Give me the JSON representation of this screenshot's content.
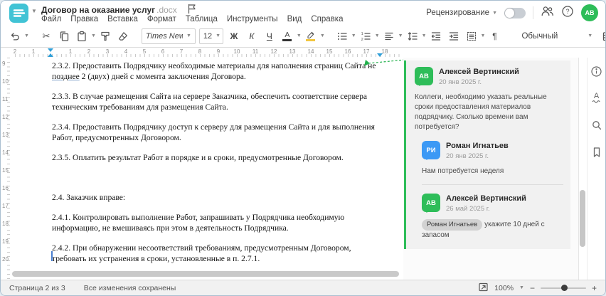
{
  "window": {
    "title": "Договор на оказание услуг",
    "title_ext": ".docx"
  },
  "menu": {
    "items": [
      "Файл",
      "Правка",
      "Вставка",
      "Формат",
      "Таблица",
      "Инструменты",
      "Вид",
      "Справка"
    ]
  },
  "topbar": {
    "review": "Рецензирование",
    "avatar_initials": "АВ"
  },
  "toolbar": {
    "font": "Times New ...",
    "size": "12",
    "bold": "Ж",
    "italic": "К",
    "underline": "Ч",
    "font_color_letter": "А",
    "style": "Обычный",
    "pilcrow": "¶",
    "more": "⋯"
  },
  "ruler": {
    "h_neg": [
      "2",
      "1"
    ],
    "h_pos": [
      "1",
      "2",
      "3",
      "4",
      "5",
      "6",
      "7",
      "8",
      "9",
      "10",
      "11",
      "12",
      "13",
      "14",
      "15",
      "16",
      "17",
      "18"
    ],
    "v": [
      "9",
      "10",
      "11",
      "12",
      "13",
      "14",
      "15",
      "16",
      "17",
      "18",
      "19",
      "20"
    ]
  },
  "doc": {
    "p1": {
      "pre": "2.3.2. Предоставить Подрядчику необходимые материалы для наполнения страниц Сайта не ",
      "underlined": "позднее",
      "post": " 2 (двух) дней с момента заключения Договора."
    },
    "p2": "2.3.3. В случае размещения Сайта на сервере Заказчика, обеспечить соответствие сервера техническим требованиям для размещения Сайта.",
    "p3": "2.3.4. Предоставить Подрядчику доступ к серверу для размещения Сайта и для выполнения Работ, предусмотренных Договором.",
    "p4": "2.3.5. Оплатить результат Работ в порядке и в сроки, предусмотренные Договором.",
    "p5": "2.4. Заказчик вправе:",
    "p6": "2.4.1. Контролировать выполнение Работ, запрашивать у Подрядчика необходимую информацию, не вмешиваясь при этом в деятельность Подрядчика.",
    "p7": "2.4.2. При обнаружении несоответствий требованиям, предусмотренным Договором, требовать их устранения в сроки, установленные в п. 2.7.1."
  },
  "comments": {
    "post1": {
      "initials": "АВ",
      "author": "Алексей Вертинский",
      "date": "20 янв 2025 г.",
      "text": "Коллеги, необходимо указать реальные сроки предоставления материалов подрядчику. Сколько времени вам потребуется?"
    },
    "reply1": {
      "initials": "РИ",
      "author": "Роман Игнатьев",
      "date": "20 янв 2025 г.",
      "text": "Нам потребуется неделя"
    },
    "reply2": {
      "initials": "АВ",
      "author": "Алексей Вертинский",
      "date": "26 май 2025 г.",
      "mention": "Роман Игнатьев",
      "text": "укажите 10 дней с запасом"
    }
  },
  "statusbar": {
    "page": "Страница 2 из 3",
    "saved": "Все изменения сохранены",
    "zoom": "100%",
    "zoom_out": "−",
    "zoom_in": "+"
  },
  "colors": {
    "teal": "#41c3d5",
    "green": "#2ebd59",
    "blue": "#3c99f5",
    "image_icon_blue": "#4a84c4",
    "marker_blue": "#2f9fd8"
  }
}
